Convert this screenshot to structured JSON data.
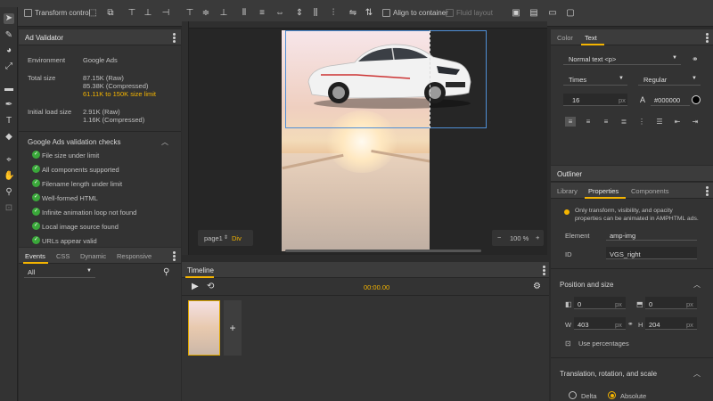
{
  "toolbar": {
    "transform_control_label": "Transform control",
    "align_to_container_label": "Align to container",
    "fluid_layout_label": "Fluid layout"
  },
  "ad_validator": {
    "title": "Ad Validator",
    "environment_label": "Environment",
    "environment_value": "Google Ads",
    "total_size_label": "Total size",
    "total_size_raw": "87.15K (Raw)",
    "total_size_compressed": "85.38K (Compressed)",
    "total_size_limit": "61.11K to 150K size limit",
    "initial_load_label": "Initial load size",
    "initial_load_raw": "2.91K (Raw)",
    "initial_load_compressed": "1.16K (Compressed)",
    "checks_header": "Google Ads validation checks",
    "checks": [
      "File size under limit",
      "All components supported",
      "Filename length under limit",
      "Well-formed HTML",
      "Infinite animation loop not found",
      "Local image source found",
      "URLs appear valid"
    ]
  },
  "events_panel": {
    "tabs": [
      "Events",
      "CSS",
      "Dynamic",
      "Responsive"
    ],
    "filter_value": "All"
  },
  "stage": {
    "page_label": "page1",
    "page_element": "Div",
    "zoom_value": "100 %",
    "zoom_minus": "−",
    "zoom_plus": "+"
  },
  "timeline": {
    "title": "Timeline",
    "time": "00:00.00",
    "add_label": "+"
  },
  "text_panel": {
    "tabs": [
      "Color",
      "Text"
    ],
    "style_value": "Normal text <p>",
    "font_value": "Times",
    "weight_value": "Regular",
    "size_value": "16",
    "size_unit": "px",
    "color_value": "#000000"
  },
  "outliner": {
    "title": "Outliner"
  },
  "properties": {
    "tabs": [
      "Library",
      "Properties",
      "Components"
    ],
    "info_text_line1": "Only transform, visibility, and opacity",
    "info_text_line2": "properties can be animated in AMPHTML ads.",
    "element_label": "Element",
    "element_value": "amp-img",
    "id_label": "ID",
    "id_value": "VGS_right",
    "position_size_header": "Position and size",
    "x_value": "0",
    "y_value": "0",
    "unit": "px",
    "w_label": "W",
    "w_value": "403",
    "h_label": "H",
    "h_value": "204",
    "use_percentages_label": "Use percentages",
    "translation_header": "Translation, rotation, and scale",
    "delta_label": "Delta",
    "absolute_label": "Absolute"
  },
  "colors": {
    "accent": "#f4b400",
    "selection": "#4f8fd6",
    "check_green": "#3aa83a"
  }
}
